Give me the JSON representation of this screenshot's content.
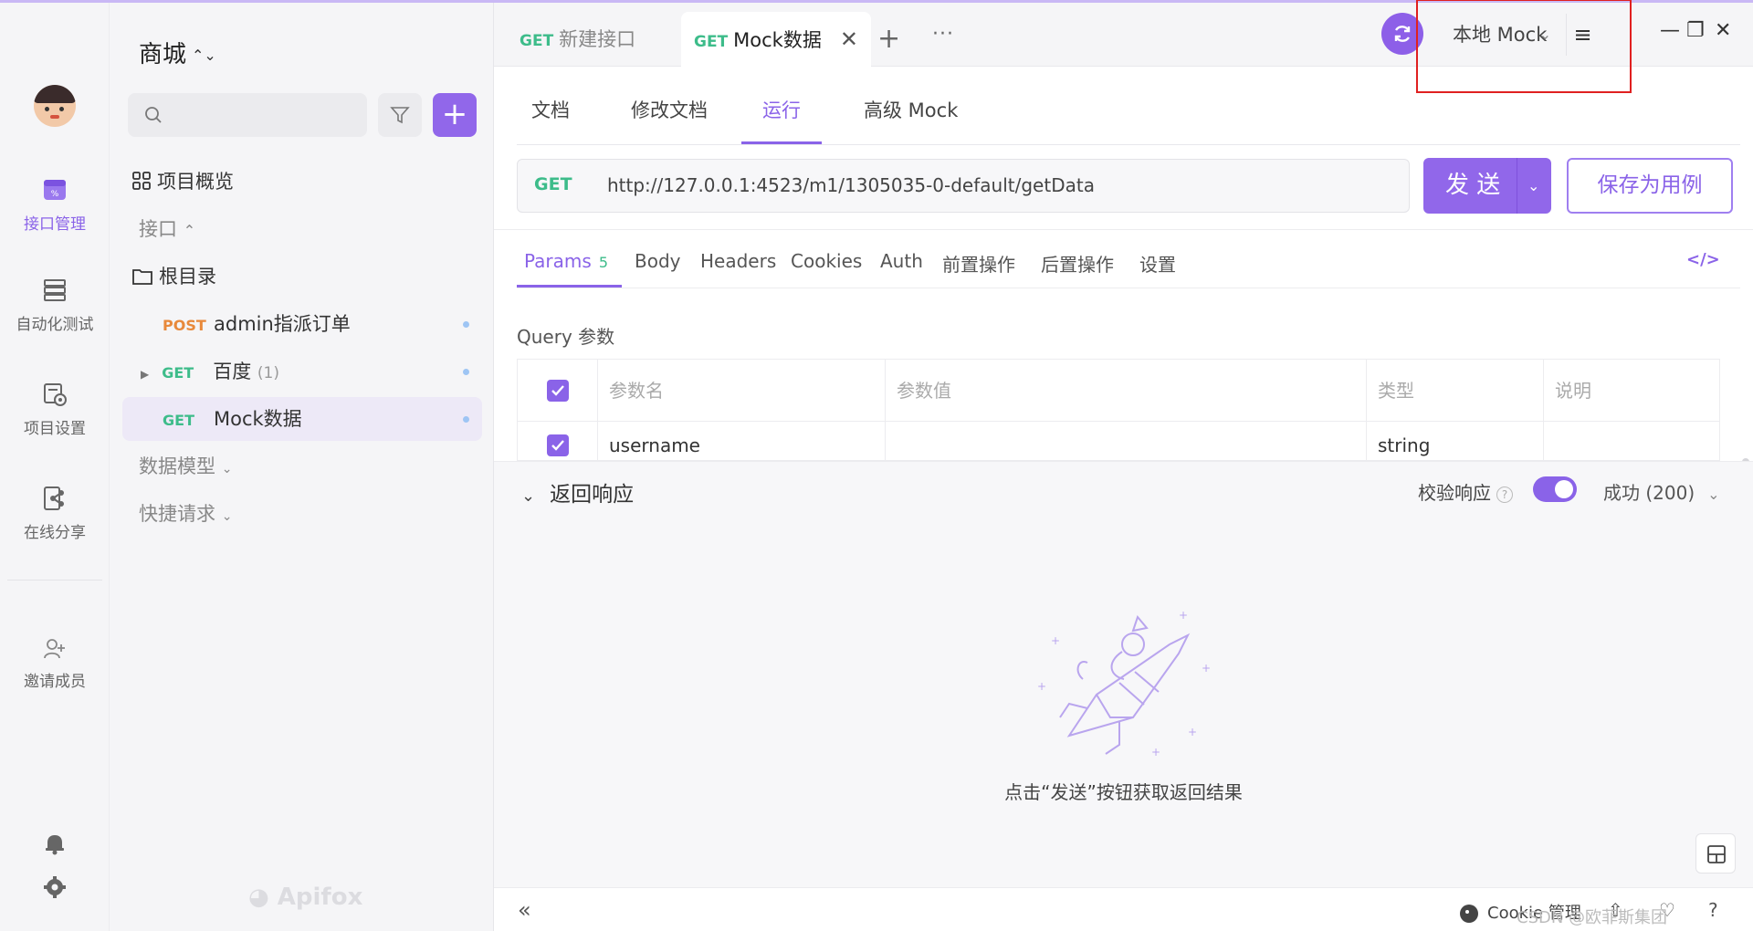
{
  "rail": {
    "items": [
      {
        "label": "接口管理",
        "icon": "api-management-icon",
        "active": true
      },
      {
        "label": "自动化测试",
        "icon": "automation-icon",
        "active": false
      },
      {
        "label": "项目设置",
        "icon": "project-settings-icon",
        "active": false
      },
      {
        "label": "在线分享",
        "icon": "share-icon",
        "active": false
      }
    ],
    "invite_label": "邀请成员"
  },
  "sidebar": {
    "project_name": "商城",
    "overview_label": "项目概览",
    "interfaces_label": "接口",
    "root_label": "根目录",
    "items": [
      {
        "method": "POST",
        "name": "admin指派订单"
      },
      {
        "method": "GET",
        "name": "百度",
        "count": "(1)"
      },
      {
        "method": "GET",
        "name": "Mock数据"
      }
    ],
    "data_model_label": "数据模型",
    "quick_request_label": "快捷请求",
    "watermark": "Apifox"
  },
  "tabs": [
    {
      "method": "GET",
      "label": "新建接口"
    },
    {
      "method": "GET",
      "label": "Mock数据"
    }
  ],
  "env": {
    "label": "本地 Mock"
  },
  "subtabs": [
    "文档",
    "修改文档",
    "运行",
    "高级 Mock"
  ],
  "request": {
    "method": "GET",
    "url": "http://127.0.0.1:4523/m1/1305035-0-default/getData",
    "send_label": "发 送",
    "save_case_label": "保存为用例"
  },
  "req_tabs": [
    {
      "label": "Params",
      "badge": "5"
    },
    {
      "label": "Body"
    },
    {
      "label": "Headers"
    },
    {
      "label": "Cookies"
    },
    {
      "label": "Auth"
    },
    {
      "label": "前置操作"
    },
    {
      "label": "后置操作"
    },
    {
      "label": "设置"
    }
  ],
  "params": {
    "section_label": "Query 参数",
    "headers": [
      "参数名",
      "参数值",
      "类型",
      "说明"
    ],
    "rows": [
      {
        "name": "username",
        "value": "",
        "type": "string",
        "desc": ""
      }
    ]
  },
  "response": {
    "title": "返回响应",
    "validate_label": "校验响应",
    "status_label": "成功 (200)",
    "empty_text": "点击“发送”按钮获取返回结果"
  },
  "footer": {
    "cookie_label": "Cookie 管理",
    "watermark": "CSDN @欧菲斯集团"
  },
  "colors": {
    "accent": "#8a63e8",
    "get": "#3dbc8a",
    "post": "#e8893b",
    "highlight_box": "#e02020"
  }
}
